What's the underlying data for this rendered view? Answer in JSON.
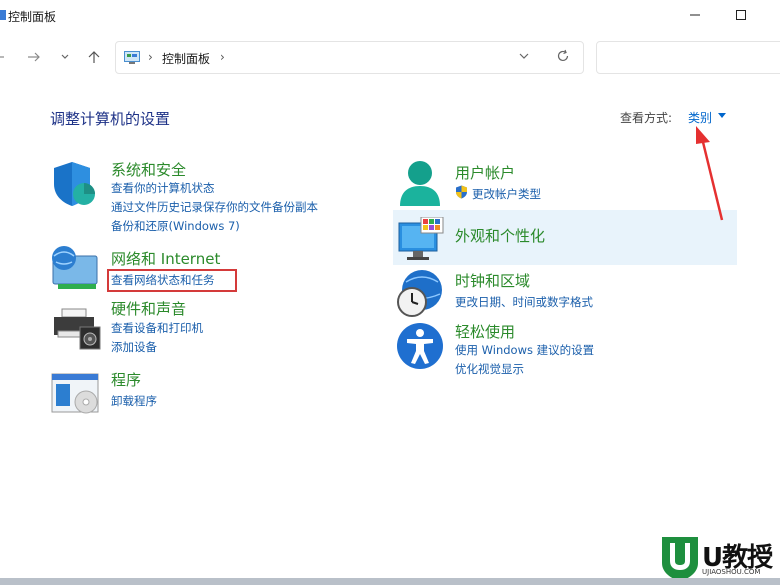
{
  "window": {
    "title": "控制面板",
    "minimize_icon": "minimize-icon",
    "maximize_icon": "maximize-icon"
  },
  "nav": {
    "back_icon": "back-arrow-icon",
    "forward_icon": "forward-arrow-icon",
    "recent_icon": "chevron-down-icon",
    "up_icon": "up-arrow-icon",
    "address_separator": "›",
    "breadcrumb": "控制面板",
    "breadcrumb_separator": "›",
    "address_dropdown_icon": "chevron-down-icon",
    "refresh_icon": "refresh-icon",
    "search_placeholder": ""
  },
  "content": {
    "heading": "调整计算机的设置",
    "view_by_label": "查看方式:",
    "view_by_value": "类别"
  },
  "categories_left": [
    {
      "title": "系统和安全",
      "icon": "shield-icon",
      "links": [
        "查看你的计算机状态",
        "通过文件历史记录保存你的文件备份副本",
        "备份和还原(Windows 7)"
      ]
    },
    {
      "title": "网络和 Internet",
      "icon": "network-monitor-icon",
      "links": [
        "查看网络状态和任务"
      ]
    },
    {
      "title": "硬件和声音",
      "icon": "printer-speaker-icon",
      "links": [
        "查看设备和打印机",
        "添加设备"
      ]
    },
    {
      "title": "程序",
      "icon": "programs-disc-icon",
      "links": [
        "卸载程序"
      ]
    }
  ],
  "categories_right": [
    {
      "title": "用户帐户",
      "icon": "user-account-icon",
      "links": [
        "更改帐户类型"
      ],
      "link_icon": "uac-shield-icon"
    },
    {
      "title": "外观和个性化",
      "icon": "display-personalize-icon",
      "links": []
    },
    {
      "title": "时钟和区域",
      "icon": "clock-globe-icon",
      "links": [
        "更改日期、时间或数字格式"
      ]
    },
    {
      "title": "轻松使用",
      "icon": "accessibility-icon",
      "links": [
        "使用 Windows 建议的设置",
        "优化视觉显示"
      ]
    }
  ],
  "watermark": {
    "brand": "U教授",
    "url": "UJIAOSHOU.COM",
    "icon": "u-shield-logo-icon"
  },
  "colors": {
    "heading": "#1e3287",
    "category_title": "#2b8a2b",
    "link": "#1b5fab",
    "highlight_row": "#e8f3fb",
    "annotation_red": "#d43a3a"
  }
}
